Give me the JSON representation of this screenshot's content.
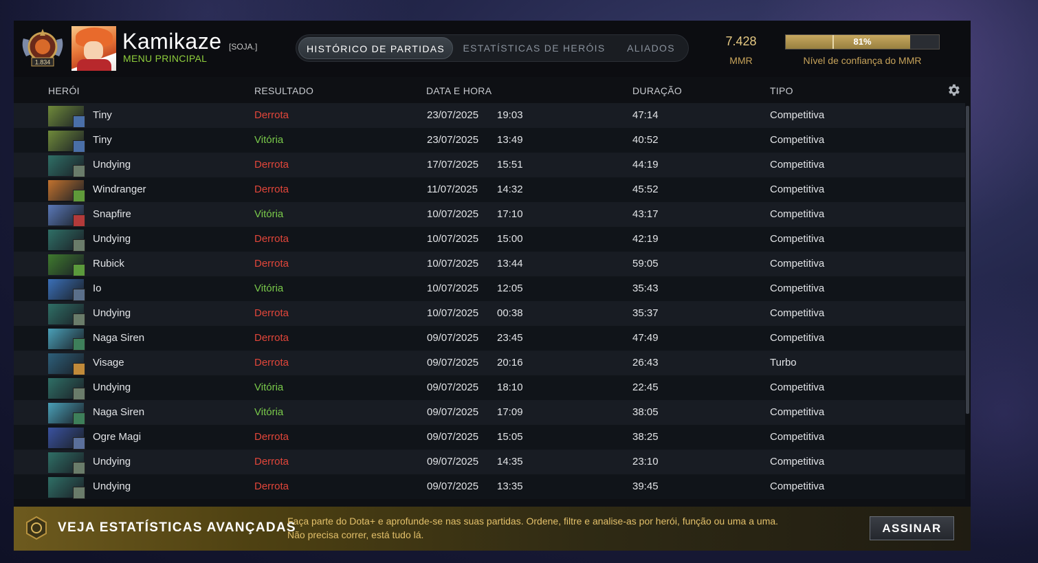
{
  "profile": {
    "name": "Kamikaze",
    "guild_tag": "[SOJA.]",
    "subtitle": "MENU PRINCIPAL",
    "rank_number": "1.834"
  },
  "tabs": [
    {
      "label": "HISTÓRICO DE PARTIDAS",
      "active": true
    },
    {
      "label": "ESTATÍSTICAS DE HERÓIS",
      "active": false
    },
    {
      "label": "ALIADOS",
      "active": false
    }
  ],
  "mmr": {
    "value": "7.428",
    "label": "MMR"
  },
  "confidence": {
    "percent_text": "81%",
    "fill_fraction": 0.81,
    "label": "Nível de confiança do MMR"
  },
  "columns": {
    "hero": "HERÓI",
    "result": "RESULTADO",
    "datetime": "DATA E HORA",
    "duration": "DURAÇÃO",
    "type": "TIPO"
  },
  "matches": [
    {
      "hero": "Tiny",
      "result": "Derrota",
      "win": false,
      "date": "23/07/2025",
      "time": "19:03",
      "duration": "47:14",
      "type": "Competitiva",
      "color": "#6f8a3a",
      "attr": "#4a6fa8"
    },
    {
      "hero": "Tiny",
      "result": "Vitória",
      "win": true,
      "date": "23/07/2025",
      "time": "13:49",
      "duration": "40:52",
      "type": "Competitiva",
      "color": "#6f8a3a",
      "attr": "#4a6fa8"
    },
    {
      "hero": "Undying",
      "result": "Derrota",
      "win": false,
      "date": "17/07/2025",
      "time": "15:51",
      "duration": "44:19",
      "type": "Competitiva",
      "color": "#2f6f66",
      "attr": "#6a7c6a"
    },
    {
      "hero": "Windranger",
      "result": "Derrota",
      "win": false,
      "date": "11/07/2025",
      "time": "14:32",
      "duration": "45:52",
      "type": "Competitiva",
      "color": "#c2722e",
      "attr": "#5f9a3a"
    },
    {
      "hero": "Snapfire",
      "result": "Vitória",
      "win": true,
      "date": "10/07/2025",
      "time": "17:10",
      "duration": "43:17",
      "type": "Competitiva",
      "color": "#5a78b8",
      "attr": "#b33a3a"
    },
    {
      "hero": "Undying",
      "result": "Derrota",
      "win": false,
      "date": "10/07/2025",
      "time": "15:00",
      "duration": "42:19",
      "type": "Competitiva",
      "color": "#2f6f66",
      "attr": "#6a7c6a"
    },
    {
      "hero": "Rubick",
      "result": "Derrota",
      "win": false,
      "date": "10/07/2025",
      "time": "13:44",
      "duration": "59:05",
      "type": "Competitiva",
      "color": "#3f7a2e",
      "attr": "#5b9a3c"
    },
    {
      "hero": "Io",
      "result": "Vitória",
      "win": true,
      "date": "10/07/2025",
      "time": "12:05",
      "duration": "35:43",
      "type": "Competitiva",
      "color": "#3a6fb8",
      "attr": "#5a6f8a"
    },
    {
      "hero": "Undying",
      "result": "Derrota",
      "win": false,
      "date": "10/07/2025",
      "time": "00:38",
      "duration": "35:37",
      "type": "Competitiva",
      "color": "#2f6f66",
      "attr": "#6a7c6a"
    },
    {
      "hero": "Naga Siren",
      "result": "Derrota",
      "win": false,
      "date": "09/07/2025",
      "time": "23:45",
      "duration": "47:49",
      "type": "Competitiva",
      "color": "#4aa0b8",
      "attr": "#3e7f5a"
    },
    {
      "hero": "Visage",
      "result": "Derrota",
      "win": false,
      "date": "09/07/2025",
      "time": "20:16",
      "duration": "26:43",
      "type": "Turbo",
      "color": "#2d5f7a",
      "attr": "#c08a3a"
    },
    {
      "hero": "Undying",
      "result": "Vitória",
      "win": true,
      "date": "09/07/2025",
      "time": "18:10",
      "duration": "22:45",
      "type": "Competitiva",
      "color": "#2f6f66",
      "attr": "#6a7c6a"
    },
    {
      "hero": "Naga Siren",
      "result": "Vitória",
      "win": true,
      "date": "09/07/2025",
      "time": "17:09",
      "duration": "38:05",
      "type": "Competitiva",
      "color": "#4aa0b8",
      "attr": "#3e7f5a"
    },
    {
      "hero": "Ogre Magi",
      "result": "Derrota",
      "win": false,
      "date": "09/07/2025",
      "time": "15:05",
      "duration": "38:25",
      "type": "Competitiva",
      "color": "#3a52a0",
      "attr": "#5a6f9a"
    },
    {
      "hero": "Undying",
      "result": "Derrota",
      "win": false,
      "date": "09/07/2025",
      "time": "14:35",
      "duration": "23:10",
      "type": "Competitiva",
      "color": "#2f6f66",
      "attr": "#6a7c6a"
    },
    {
      "hero": "Undying",
      "result": "Derrota",
      "win": false,
      "date": "09/07/2025",
      "time": "13:35",
      "duration": "39:45",
      "type": "Competitiva",
      "color": "#2f6f66",
      "attr": "#6a7c6a"
    }
  ],
  "promo": {
    "title": "VEJA ESTATÍSTICAS AVANÇADAS",
    "line1": "Faça parte do Dota+ e aprofunde-se nas suas partidas. Ordene, filtre e analise-as por herói, função ou uma a uma.",
    "line2": "Não precisa correr, está tudo lá.",
    "button": "ASSINAR"
  },
  "icons": {
    "settings": "gear-icon",
    "rank": "rank-medal-icon",
    "promo": "dota-plus-icon"
  }
}
